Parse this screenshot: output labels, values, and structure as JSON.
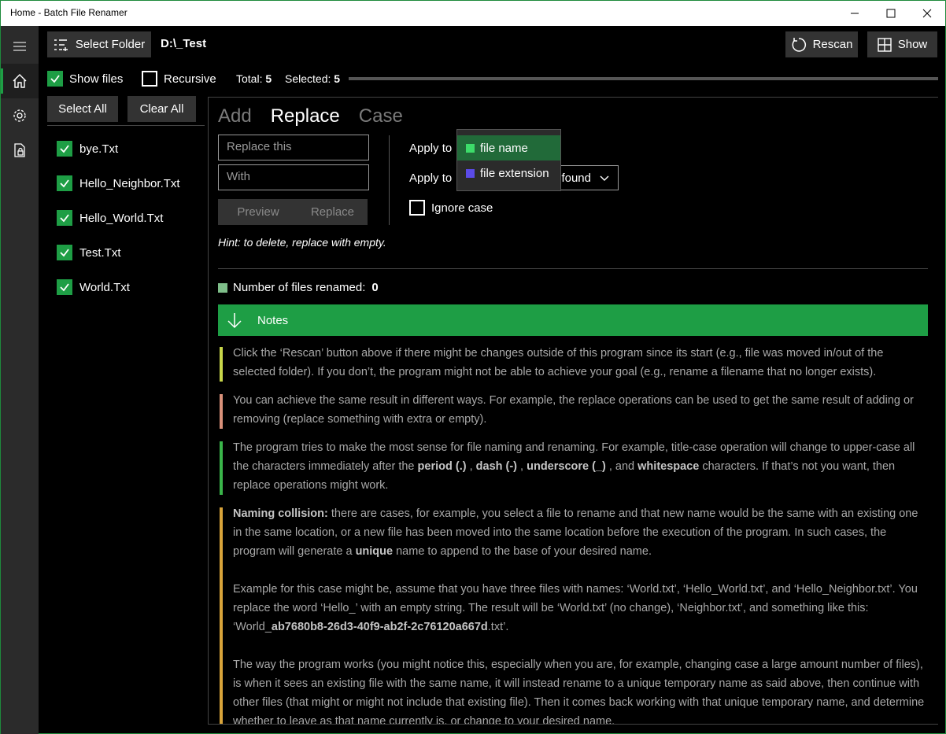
{
  "window": {
    "title": "Home - Batch File Renamer"
  },
  "toolbar": {
    "select_folder_label": "Select Folder",
    "folder_path": "D:\\_Test",
    "rescan_label": "Rescan",
    "show_label": "Show"
  },
  "options": {
    "show_files_label": "Show files",
    "show_files_checked": true,
    "recursive_label": "Recursive",
    "recursive_checked": false,
    "total_label": "Total:",
    "total_value": "5",
    "selected_label": "Selected:",
    "selected_value": "5"
  },
  "list_actions": {
    "select_all_label": "Select All",
    "clear_all_label": "Clear All"
  },
  "files": [
    {
      "name": "bye.Txt",
      "checked": true
    },
    {
      "name": "Hello_Neighbor.Txt",
      "checked": true
    },
    {
      "name": "Hello_World.Txt",
      "checked": true
    },
    {
      "name": "Test.Txt",
      "checked": true
    },
    {
      "name": "World.Txt",
      "checked": true
    }
  ],
  "tabs": [
    {
      "label": "Add",
      "selected": false
    },
    {
      "label": "Replace",
      "selected": true
    },
    {
      "label": "Case",
      "selected": false
    }
  ],
  "replace": {
    "find_placeholder": "Replace this",
    "with_placeholder": "With",
    "preview_label": "Preview",
    "replace_label": "Replace",
    "apply_to_label_1": "Apply to",
    "apply_to_label_2": "Apply to",
    "occurrence_value": "found",
    "ignore_case_label": "Ignore case",
    "ignore_case_checked": false,
    "hint": "Hint: to delete, replace with empty."
  },
  "dropdown": {
    "options": [
      {
        "label": "file name",
        "color": "#3ddc6a",
        "selected": true
      },
      {
        "label": "file extension",
        "color": "#5b4be8",
        "selected": false
      }
    ]
  },
  "status": {
    "renamed_label": "Number of files renamed:",
    "renamed_value": "0"
  },
  "notes": {
    "title": "Notes",
    "items": [
      {
        "color": "#c8d64a",
        "text": "Click the ‘Rescan’ button above if there might be changes outside of this program since its start (e.g., file was moved in/out of the selected folder). If you don’t, the program might not be able to achieve your goal (e.g., rename a filename that no longer exists)."
      },
      {
        "color": "#d9917a",
        "text": "You can achieve the same result in different ways. For example, the replace operations can be used to get the same result of adding or removing (replace something with extra or empty)."
      },
      {
        "color": "#3ab54a",
        "text_a": "The program tries to make the most sense for file naming and renaming. For example, title-case operation will change to upper-case all the characters immediately after the ",
        "b1": "period (.)",
        "sep1": " , ",
        "b2": "dash (-)",
        "sep2": " , ",
        "b3": "underscore (_)",
        "sep3": " , and ",
        "b4": "whitespace",
        "text_b": " characters. If that’s not you want, then replace operations might work."
      },
      {
        "color": "#d9a43a",
        "lead": "Naming collision:",
        "p1_a": " there are cases, for example, you select a file to rename and that new name would be the same with an existing one in the same location, or a new file has been moved into the same location before the execution of the program. In such cases, the program will generate a ",
        "p1_b": "unique",
        "p1_c": " name to append to the base of your desired name.",
        "p2_a": "Example for this case might be, assume that you have three files with names: ‘World.txt’, ‘Hello_World.txt’, and ‘Hello_Neighbor.txt’. You replace the word ‘Hello_’ with an empty string. The result will be ‘World.txt’ (no change), ‘Neighbor.txt’, and something like this: ‘World_",
        "p2_b": "ab7680b8-26d3-40f9-ab2f-2c76120a667d",
        "p2_c": ".txt’.",
        "p3": "The way the program works (you might notice this, especially when you are, for example, changing case a large amount number of files), is when it sees an existing file with the same name, it will instead rename to a unique temporary name as said above, then continue with other files (that might or might not include that existing file). Then it comes back working with that unique temporary name, and determine whether to leave as that name currently is, or change to your desired name."
      }
    ]
  }
}
